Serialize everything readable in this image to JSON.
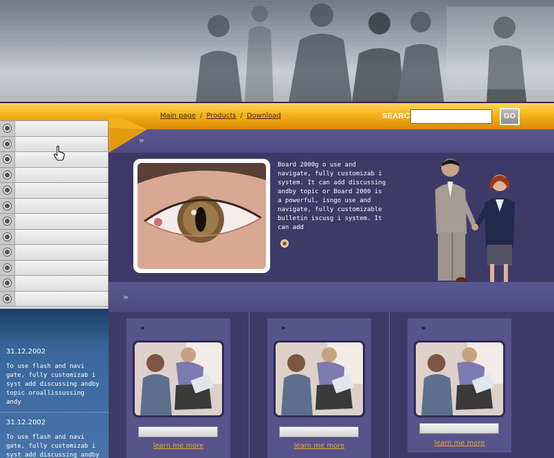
{
  "nav": {
    "links": [
      "Main page",
      "Products",
      "Download"
    ],
    "separator": "/",
    "search_label": "SEARCH",
    "search_value": "",
    "go_label": "GO"
  },
  "left_menu": {
    "items": [
      "",
      "",
      "",
      "",
      "",
      "",
      "",
      "",
      "",
      "",
      "",
      ""
    ]
  },
  "feature": {
    "text": "Board 2000g o use and navigate, fully customizab i system. It can add discussing andby topic or Board 2000 is a powerful, isngo use and navigate, fully customizable bulletin iscusg i system. It can add"
  },
  "news": [
    {
      "date": "31.12.2002",
      "text": "To use flash and navi gate, fully customizab i syst add discussing andby topic oroallissussing andy"
    },
    {
      "date": "31.12.2002",
      "text": "To use flash and navi gate, fully customizab i syst add discussing andby topic"
    }
  ],
  "cards": [
    {
      "link": "learn me more"
    },
    {
      "link": "learn me more"
    },
    {
      "link": "learn me more"
    }
  ],
  "colors": {
    "nav_orange": "#f4b21a",
    "panel_purple": "#3e3a68",
    "band_purple": "#4e4a81",
    "news_blue": "#3a679c",
    "link_orange": "#f0a92a"
  }
}
